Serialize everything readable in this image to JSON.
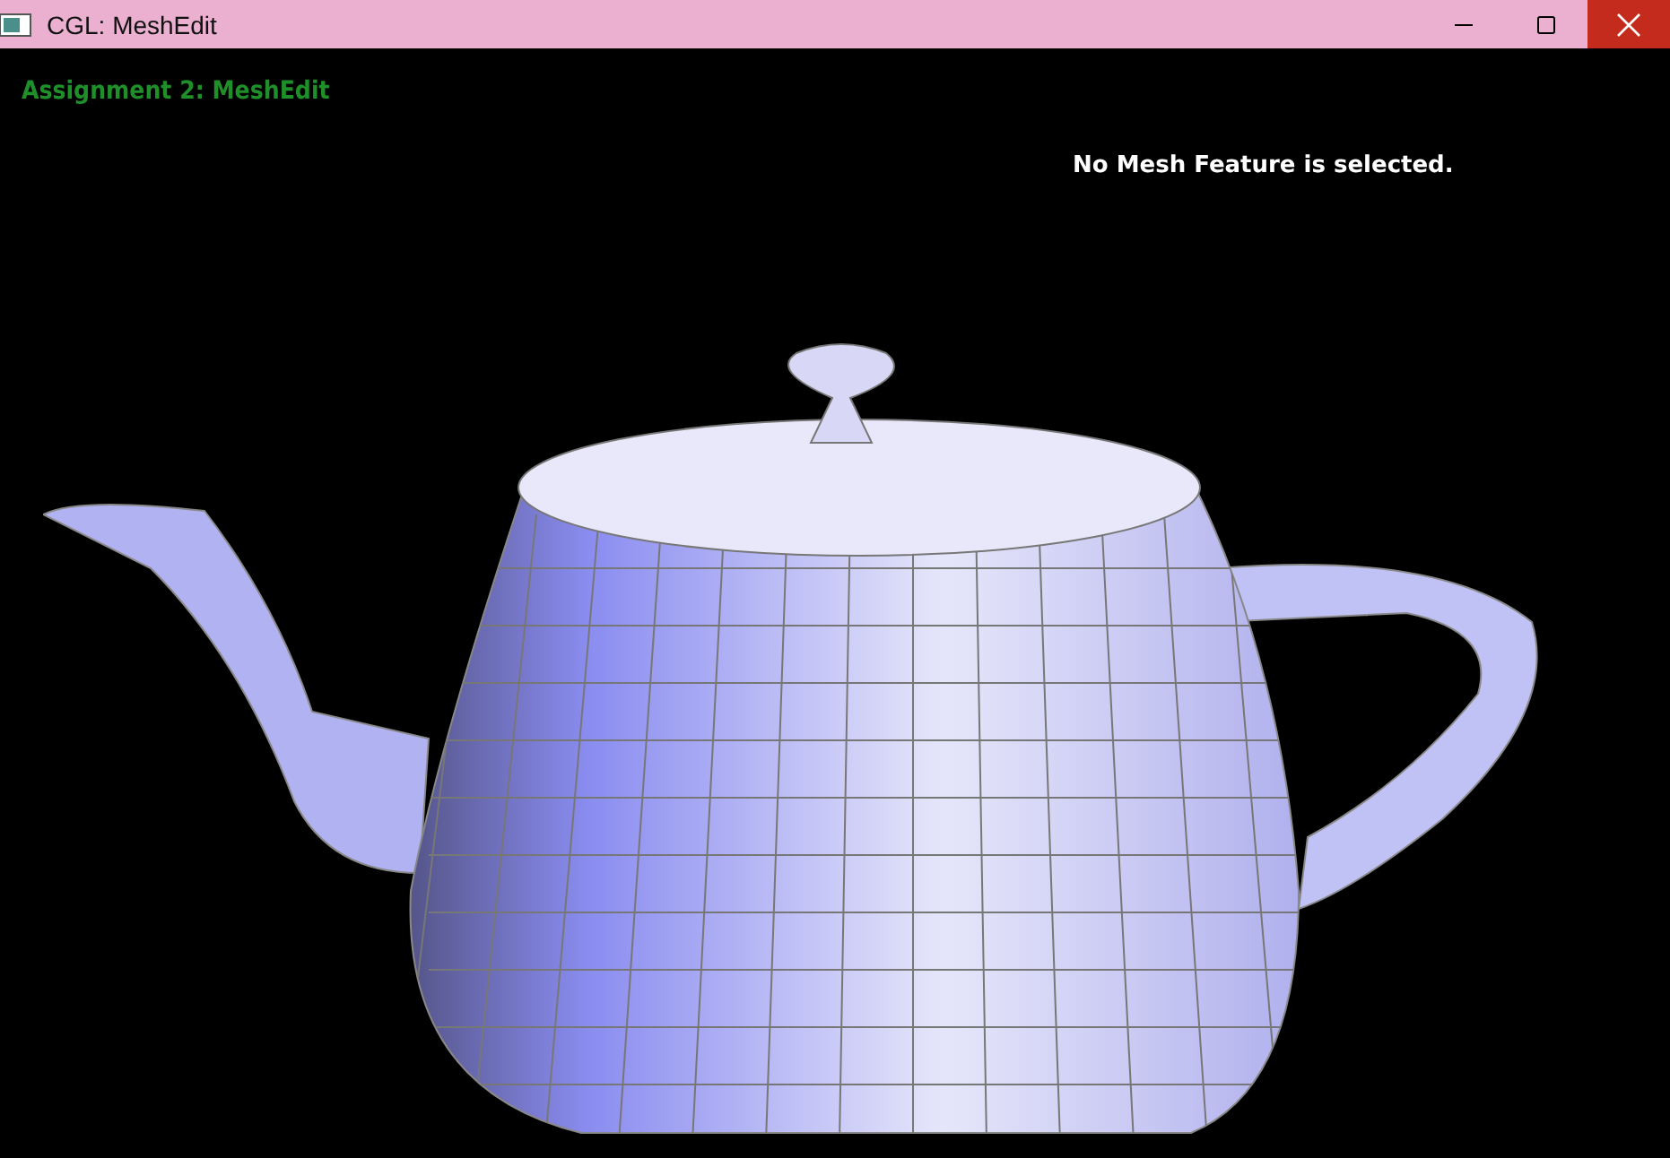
{
  "window": {
    "title": "CGL: MeshEdit"
  },
  "viewport": {
    "heading": "Assignment 2: MeshEdit",
    "status": "No Mesh Feature is selected."
  }
}
